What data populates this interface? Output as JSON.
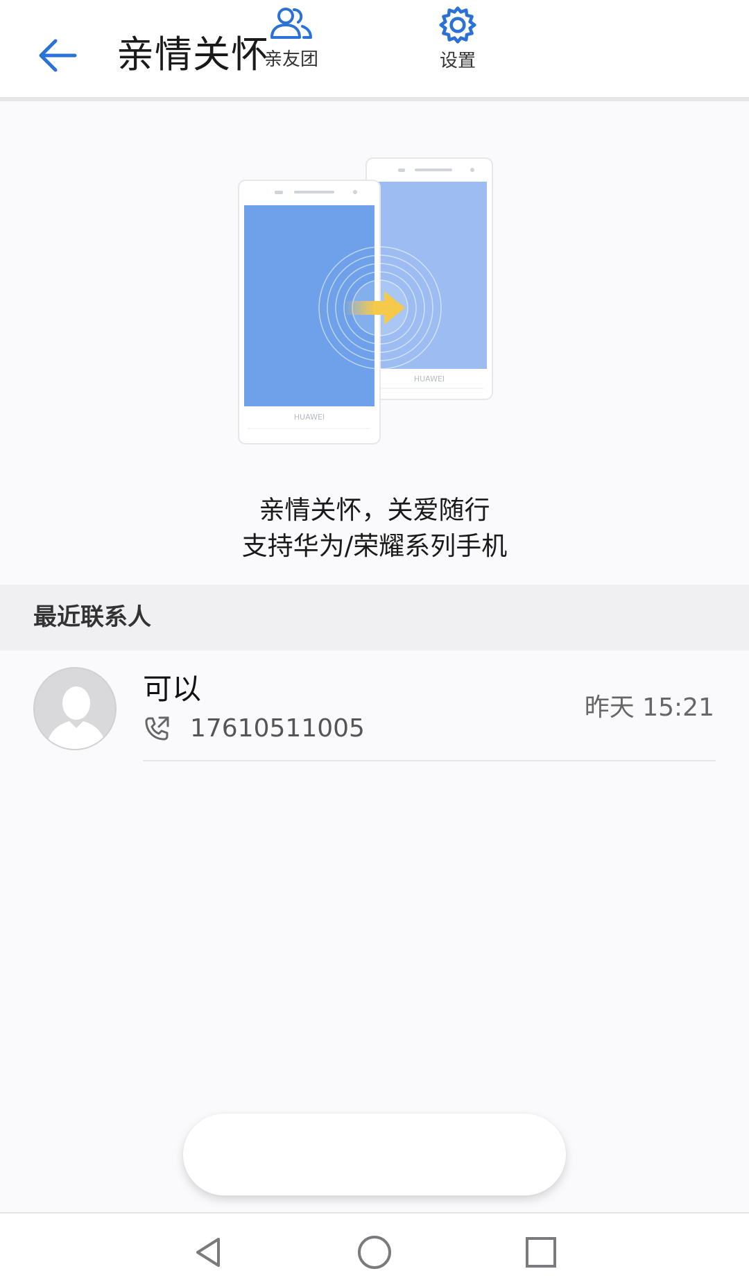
{
  "header": {
    "title": "亲情关怀",
    "back_icon": "arrow-left-icon"
  },
  "illustration": {
    "front_phone_brand": "HUAWEI",
    "back_phone_brand": "HUAWEI",
    "front_screen_color": "#6ea1ea",
    "back_screen_color": "#9cbcf2",
    "arrow_color": "#f5c94a"
  },
  "caption": {
    "line1": "亲情关怀，关爱随行",
    "line2": "支持华为/荣耀系列手机"
  },
  "recent_contacts": {
    "title": "最近联系人",
    "items": [
      {
        "name": "可以",
        "phone": "17610511005",
        "time": "昨天 15:21",
        "avatar_icon": "default-avatar-icon",
        "call_icon": "outgoing-call-icon"
      }
    ]
  },
  "bottom_bar": {
    "group_label": "亲友团",
    "group_icon": "people-icon",
    "settings_label": "设置",
    "settings_icon": "gear-icon",
    "accent_color": "#2a72d8"
  },
  "system_nav": {
    "back_icon": "triangle-back-icon",
    "home_icon": "circle-home-icon",
    "recent_icon": "square-recent-icon"
  }
}
